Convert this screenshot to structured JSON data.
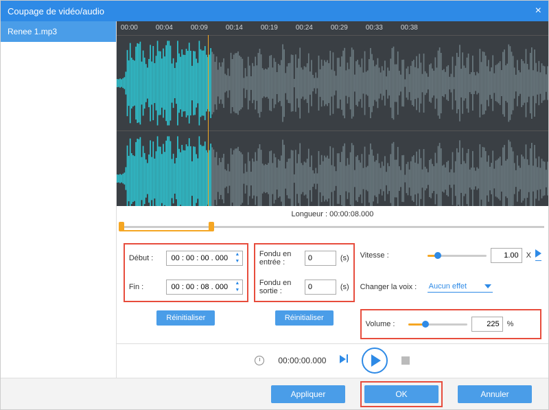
{
  "title": "Coupage de vidéo/audio",
  "file": "Renee 1.mp3",
  "ruler": [
    "00:00",
    "00:04",
    "00:09",
    "00:14",
    "00:19",
    "00:24",
    "00:29",
    "00:33",
    "00:38"
  ],
  "length_label": "Longueur : 00:00:08.000",
  "trim": {
    "start_label": "Début :",
    "start_value": "00 : 00 : 00 . 000",
    "end_label": "Fin :",
    "end_value": "00 : 00 : 08 . 000",
    "reset": "Réinitialiser"
  },
  "fade": {
    "in_label": "Fondu en entrée :",
    "in_value": "0",
    "out_label": "Fondu en sortie :",
    "out_value": "0",
    "unit": "(s)",
    "reset": "Réinitialiser"
  },
  "speed": {
    "label": "Vitesse :",
    "value": "1.00",
    "suffix": "X",
    "percent": 18
  },
  "voice": {
    "label": "Changer la voix :",
    "value": "Aucun effet"
  },
  "volume": {
    "label": "Volume :",
    "value": "225",
    "suffix": "%",
    "percent": 30
  },
  "player_time": "00:00:00.000",
  "footer": {
    "apply": "Appliquer",
    "ok": "OK",
    "cancel": "Annuler"
  }
}
